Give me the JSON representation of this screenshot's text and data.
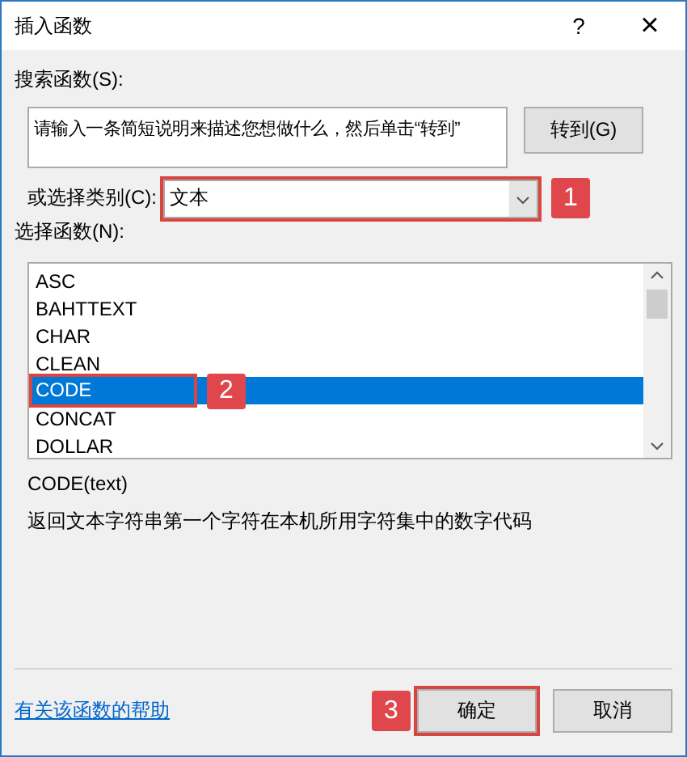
{
  "window": {
    "title": "插入函数",
    "help": "?",
    "close": "×"
  },
  "search": {
    "label": "搜索函数(S):",
    "value": "请输入一条简短说明来描述您想做什么，然后单击“转到”",
    "button": "转到(G)"
  },
  "category": {
    "label": "或选择类别(C):",
    "value": "文本",
    "callout": "1"
  },
  "functions": {
    "label": "选择函数(N):",
    "items": [
      {
        "name": "ASC",
        "selected": false
      },
      {
        "name": "BAHTTEXT",
        "selected": false
      },
      {
        "name": "CHAR",
        "selected": false
      },
      {
        "name": "CLEAN",
        "selected": false
      },
      {
        "name": "CODE",
        "selected": true,
        "callout": "2"
      },
      {
        "name": "CONCAT",
        "selected": false
      },
      {
        "name": "DOLLAR",
        "selected": false
      }
    ]
  },
  "signature": "CODE(text)",
  "description": "返回文本字符串第一个字符在本机所用字符集中的数字代码",
  "help_link": "有关该函数的帮助",
  "buttons": [
    {
      "label": "确定",
      "callout": "3"
    },
    {
      "label": "取消"
    }
  ]
}
